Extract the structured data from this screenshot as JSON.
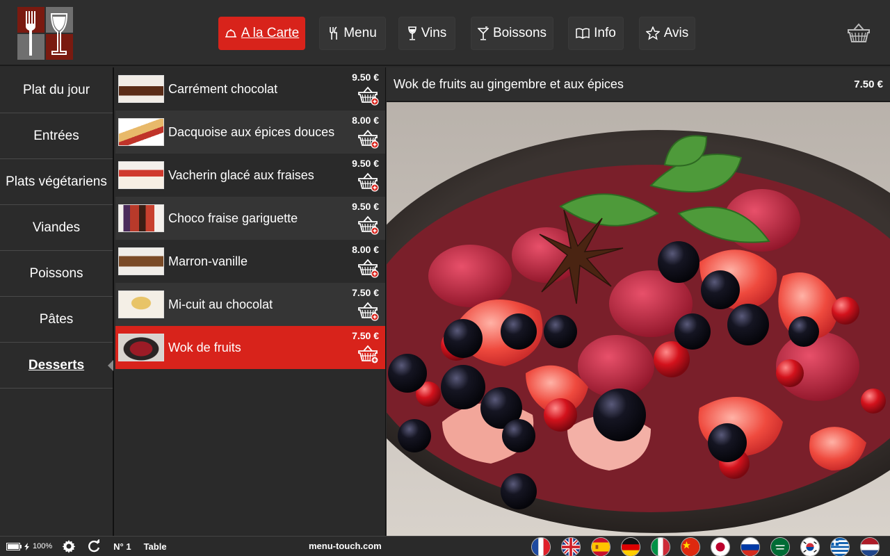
{
  "header": {
    "nav": [
      {
        "label": "A la Carte",
        "icon": "cloche-icon",
        "active": true
      },
      {
        "label": "Menu",
        "icon": "cutlery-icon"
      },
      {
        "label": "Vins",
        "icon": "wine-glass-icon"
      },
      {
        "label": "Boissons",
        "icon": "cocktail-icon"
      },
      {
        "label": "Info",
        "icon": "book-icon"
      },
      {
        "label": "Avis",
        "icon": "star-icon"
      }
    ],
    "cart_icon": "basket-icon"
  },
  "sidebar": {
    "items": [
      {
        "label": "Plat du jour"
      },
      {
        "label": "Entrées"
      },
      {
        "label": "Plats végétariens"
      },
      {
        "label": "Viandes"
      },
      {
        "label": "Poissons"
      },
      {
        "label": "Pâtes"
      },
      {
        "label": "Desserts",
        "active": true
      }
    ]
  },
  "products": [
    {
      "name": "Carrément chocolat",
      "price": "9.50 €"
    },
    {
      "name": "Dacquoise aux épices douces",
      "price": "8.00 €"
    },
    {
      "name": "Vacherin glacé aux fraises",
      "price": "9.50 €"
    },
    {
      "name": "Choco fraise gariguette",
      "price": "9.50 €"
    },
    {
      "name": "Marron-vanille",
      "price": "8.00 €"
    },
    {
      "name": "Mi-cuit au chocolat",
      "price": "7.50 €"
    },
    {
      "name": "Wok de fruits",
      "price": "7.50 €",
      "active": true
    }
  ],
  "detail": {
    "title": "Wok de fruits au gingembre et aux épices",
    "price": "7.50 €"
  },
  "footer": {
    "battery": "100%",
    "table_number": "N° 1",
    "table_label": "Table",
    "site": "menu-touch.com",
    "languages": [
      "fr",
      "en",
      "es",
      "de",
      "it",
      "zh",
      "ja",
      "ru",
      "ar",
      "ko",
      "el",
      "nl"
    ]
  },
  "colors": {
    "accent": "#d8231b",
    "background": "#2b2b2b"
  }
}
